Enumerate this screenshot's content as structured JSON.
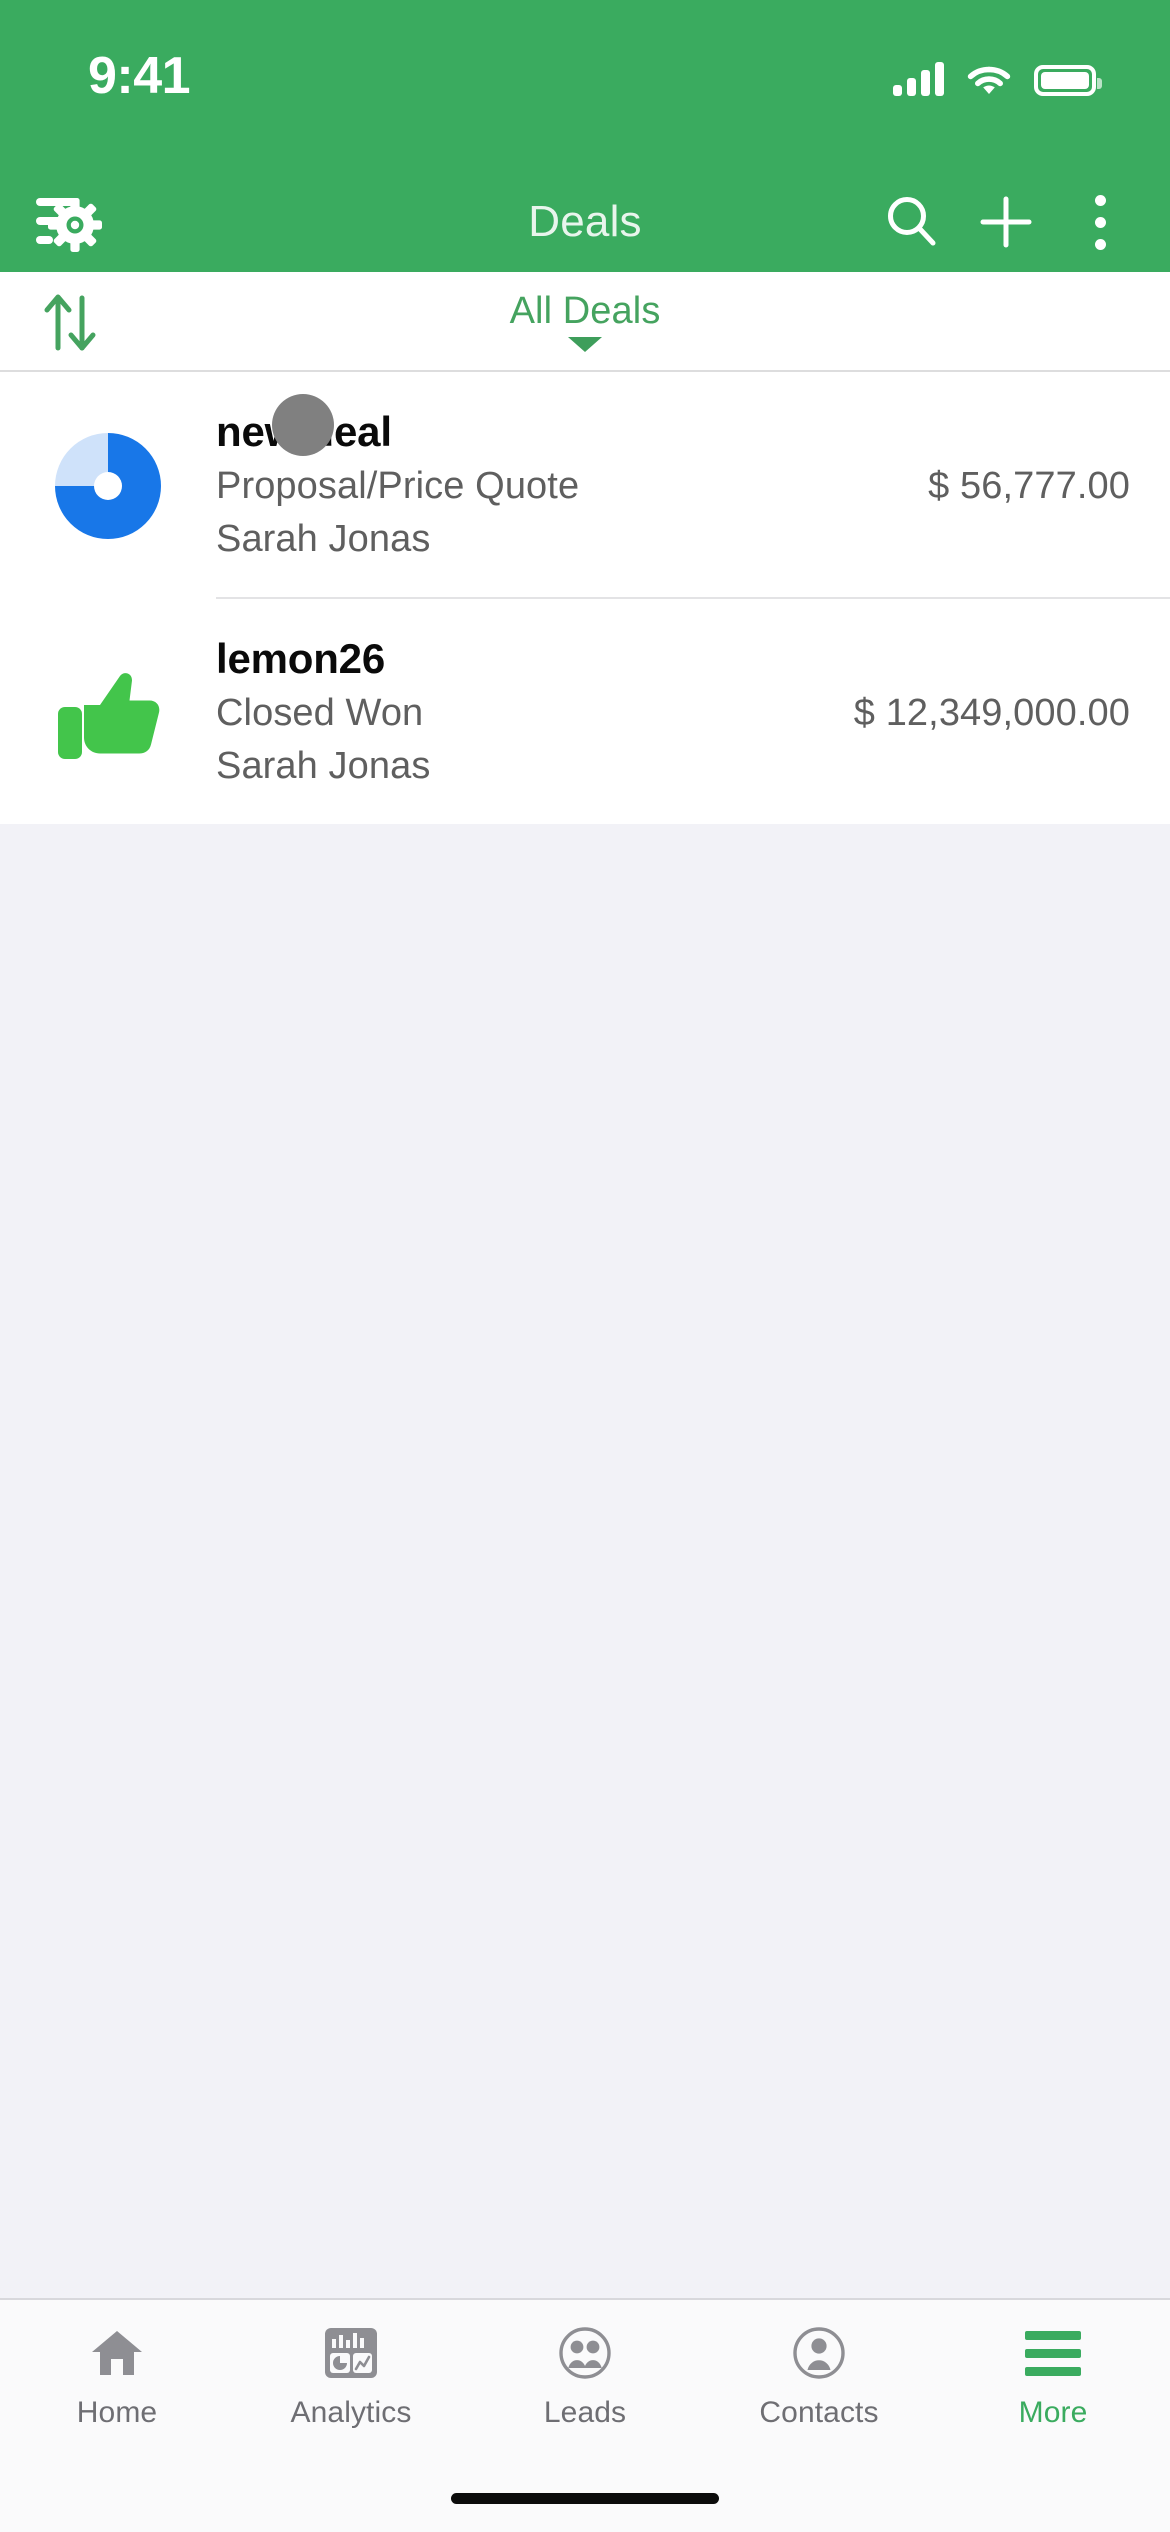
{
  "theme": {
    "brand_green": "#3AAB5F",
    "accent_green": "#45A35F",
    "pie_blue": "#1877E8",
    "pie_blue_light": "#CFE2FA",
    "thumb_green": "#43C54B",
    "body_bg": "#F2F2F7"
  },
  "status_bar": {
    "time": "9:41",
    "signal_icon": "cellular-signal-icon",
    "signal_bars": 4,
    "wifi_icon": "wifi-icon",
    "battery_icon": "battery-full-icon",
    "battery_level": 100
  },
  "nav_bar": {
    "filter_settings_icon": "filter-settings-icon",
    "title": "Deals",
    "search_icon": "search-icon",
    "add_icon": "plus-icon",
    "overflow_icon": "more-vertical-icon"
  },
  "filter_bar": {
    "sort_icon": "sort-arrows-icon",
    "scope_label": "All Deals",
    "caret_icon": "chevron-down-icon"
  },
  "deals": [
    {
      "icon": "pie-chart-progress-icon",
      "title": "new deal",
      "stage": "Proposal/Price Quote",
      "amount": "$ 56,777.00",
      "owner": "Sarah Jonas",
      "progress_percent": 75
    },
    {
      "icon": "thumbs-up-icon",
      "title": "lemon26",
      "stage": "Closed Won",
      "amount": "$ 12,349,000.00",
      "owner": "Sarah Jonas"
    }
  ],
  "tab_bar": {
    "items": [
      {
        "label": "Home",
        "icon": "home-icon",
        "active": false
      },
      {
        "label": "Analytics",
        "icon": "analytics-icon",
        "active": false
      },
      {
        "label": "Leads",
        "icon": "leads-icon",
        "active": false
      },
      {
        "label": "Contacts",
        "icon": "contacts-icon",
        "active": false
      },
      {
        "label": "More",
        "icon": "more-menu-icon",
        "active": true
      }
    ]
  },
  "home_indicator": "home-indicator-bar"
}
